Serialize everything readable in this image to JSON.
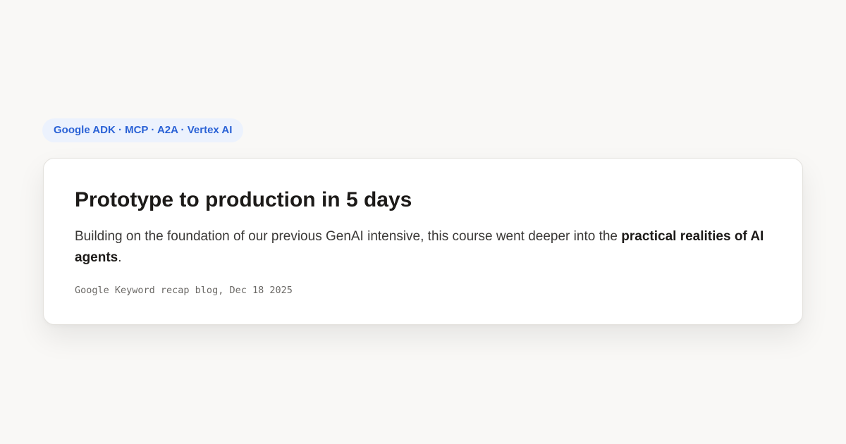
{
  "tag": {
    "label": "Google ADK · MCP · A2A · Vertex AI"
  },
  "card": {
    "title": "Prototype to production in 5 days",
    "body_prefix": "Building on the foundation of our previous GenAI intensive, this course went deeper into the ",
    "body_emphasis": "practical realities of AI agents",
    "body_suffix": ".",
    "source": "Google Keyword recap blog, Dec 18 2025"
  },
  "colors": {
    "page_background": "#f9f8f6",
    "tag_background": "#ecf2fd",
    "tag_text": "#2a62d6",
    "card_background": "#ffffff",
    "title_text": "#1c1a18"
  }
}
